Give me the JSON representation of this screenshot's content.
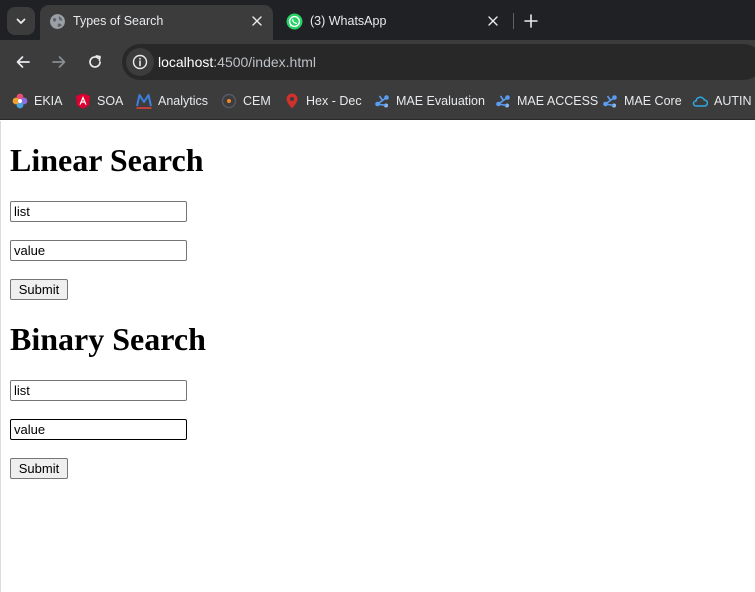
{
  "browser": {
    "tabs": [
      {
        "title": "Types of Search",
        "active": true,
        "icon": "globe-icon"
      },
      {
        "title": "(3) WhatsApp",
        "active": false,
        "icon": "whatsapp-icon"
      }
    ],
    "url": {
      "host": "localhost",
      "path": ":4500/index.html"
    },
    "bookmarks": [
      {
        "label": "EKIA",
        "icon": "ekia-icon"
      },
      {
        "label": "SOA",
        "icon": "angular-icon"
      },
      {
        "label": "Analytics",
        "icon": "analytics-icon"
      },
      {
        "label": "CEM",
        "icon": "cem-icon"
      },
      {
        "label": "Hex - Dec",
        "icon": "location-pin-icon"
      },
      {
        "label": "MAE Evaluation",
        "icon": "mae-icon"
      },
      {
        "label": "MAE ACCESS",
        "icon": "mae-icon"
      },
      {
        "label": "MAE Core",
        "icon": "mae-icon"
      },
      {
        "label": "AUTIN",
        "icon": "cloud-icon"
      }
    ],
    "colors": {
      "tabbar": "#202124",
      "toolbar": "#3c3c3c",
      "whatsapp": "#25d366"
    }
  },
  "page": {
    "linear": {
      "heading": "Linear Search",
      "list_placeholder": "list",
      "value_placeholder": "value",
      "submit_label": "Submit"
    },
    "binary": {
      "heading": "Binary Search",
      "list_placeholder": "list",
      "value_placeholder": "value",
      "submit_label": "Submit"
    }
  }
}
